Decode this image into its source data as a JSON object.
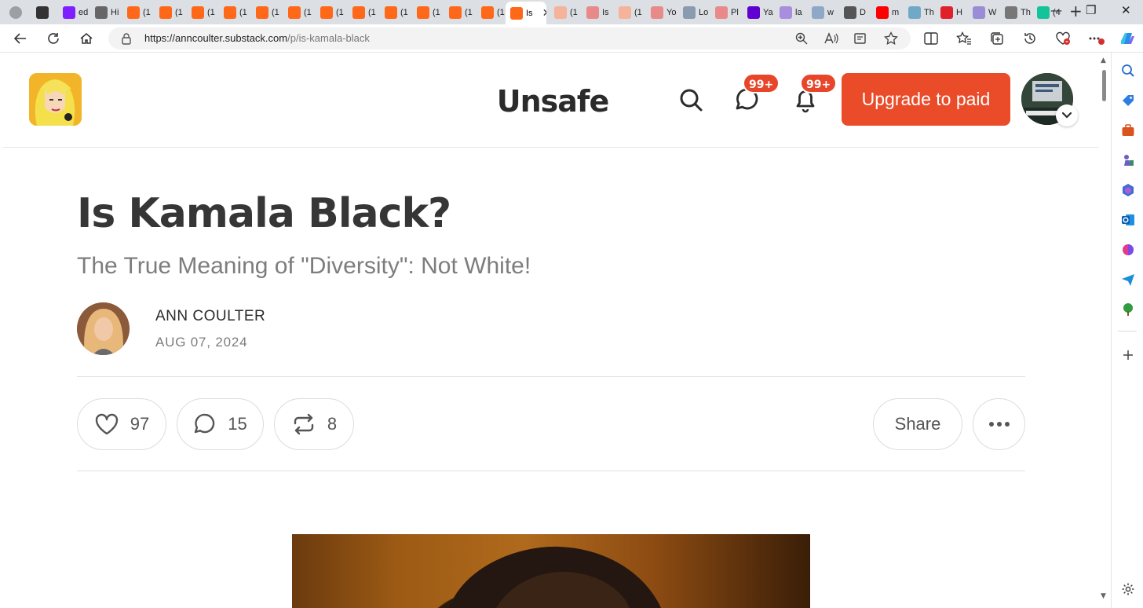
{
  "browser": {
    "tabs": [
      {
        "label": "",
        "favicon": "profile-avatar",
        "color": "#9aa0a6"
      },
      {
        "label": "",
        "favicon": "tab-actions",
        "color": "#333333"
      },
      {
        "label": "ed",
        "favicon": "yahoo-mail",
        "color": "#7e1fff"
      },
      {
        "label": "Hi",
        "favicon": "history",
        "color": "#666666"
      },
      {
        "label": "(1",
        "favicon": "substack",
        "color": "#ff6719"
      },
      {
        "label": "(1",
        "favicon": "substack",
        "color": "#ff6719"
      },
      {
        "label": "(1",
        "favicon": "substack",
        "color": "#ff6719"
      },
      {
        "label": "(1",
        "favicon": "substack",
        "color": "#ff6719"
      },
      {
        "label": "(1",
        "favicon": "substack",
        "color": "#ff6719"
      },
      {
        "label": "(1",
        "favicon": "substack",
        "color": "#ff6719"
      },
      {
        "label": "(1",
        "favicon": "substack",
        "color": "#ff6719"
      },
      {
        "label": "(1",
        "favicon": "substack",
        "color": "#ff6719"
      },
      {
        "label": "(1",
        "favicon": "substack",
        "color": "#ff6719"
      },
      {
        "label": "(1",
        "favicon": "substack",
        "color": "#ff6719"
      },
      {
        "label": "(1",
        "favicon": "substack",
        "color": "#ff6719"
      },
      {
        "label": "(1",
        "favicon": "substack",
        "color": "#ff6719"
      },
      {
        "label": "Is",
        "favicon": "substack",
        "color": "#ff6719",
        "active": true
      },
      {
        "label": "(1",
        "favicon": "substack",
        "color": "#f4b39a"
      },
      {
        "label": "Is",
        "favicon": "youtube",
        "color": "#e88a8a"
      },
      {
        "label": "(1",
        "favicon": "substack",
        "color": "#f4b39a"
      },
      {
        "label": "Yo",
        "favicon": "youtube",
        "color": "#e88a8a"
      },
      {
        "label": "Lo",
        "favicon": "letter-l",
        "color": "#8a9bb0"
      },
      {
        "label": "Pl",
        "favicon": "youtube",
        "color": "#e88a8a"
      },
      {
        "label": "Ya",
        "favicon": "yahoo",
        "color": "#6001d2"
      },
      {
        "label": "la",
        "favicon": "yahoo-mail",
        "color": "#a98ee0"
      },
      {
        "label": "w",
        "favicon": "search",
        "color": "#8fa8c8"
      },
      {
        "label": "D",
        "favicon": "slashes",
        "color": "#555555"
      },
      {
        "label": "m",
        "favicon": "youtube",
        "color": "#ff0000"
      },
      {
        "label": "Th",
        "favicon": "image",
        "color": "#6fa9c7"
      },
      {
        "label": "H",
        "favicon": "red-pin",
        "color": "#e0202a"
      },
      {
        "label": "W",
        "favicon": "shield",
        "color": "#9b8cd6"
      },
      {
        "label": "Th",
        "favicon": "dots",
        "color": "#777777"
      },
      {
        "label": "(4",
        "favicon": "grammarly",
        "color": "#15c39a"
      }
    ],
    "url_host": "https://anncoulter.substack.com",
    "url_path": "/p/is-kamala-black"
  },
  "header": {
    "publication_name": "Unsafe",
    "chat_badge": "99+",
    "notifications_badge": "99+",
    "upgrade_label": "Upgrade to paid",
    "accent_color": "#ea4c2a"
  },
  "article": {
    "title": "Is Kamala Black?",
    "subtitle": "The True Meaning of \"Diversity\": Not White!",
    "author": "ANN COULTER",
    "date": "AUG 07, 2024",
    "likes": "97",
    "comments": "15",
    "restacks": "8",
    "share_label": "Share"
  }
}
